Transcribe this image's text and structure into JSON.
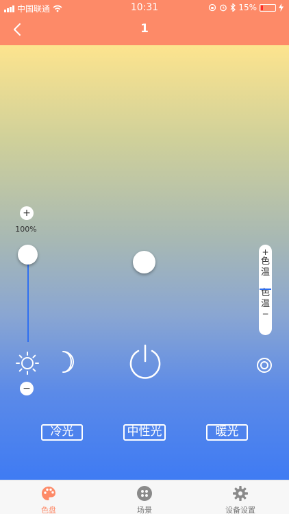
{
  "status": {
    "carrier": "中国联通",
    "time": "10:31",
    "battery": "15%"
  },
  "nav": {
    "title": "1",
    "back_icon": "chevron-left-icon"
  },
  "brightness": {
    "plus_label": "+",
    "minus_label": "−",
    "percent_label": "100%",
    "value_percent": 100
  },
  "color_temp": {
    "plus_label": "+",
    "minus_label": "−",
    "label_top": "色温",
    "label_bottom": "色温"
  },
  "presets": {
    "cool": "冷光",
    "neutral": "中性光",
    "warm": "暖光"
  },
  "tabs": [
    {
      "label": "色盘",
      "icon": "palette-icon",
      "active": true
    },
    {
      "label": "场景",
      "icon": "scene-grid-icon",
      "active": false
    },
    {
      "label": "设备设置",
      "icon": "gear-icon",
      "active": false
    }
  ],
  "colors": {
    "accent": "#fd8a68",
    "slider_blue": "#2f6ff0",
    "battery_low": "#ff2a2a"
  }
}
